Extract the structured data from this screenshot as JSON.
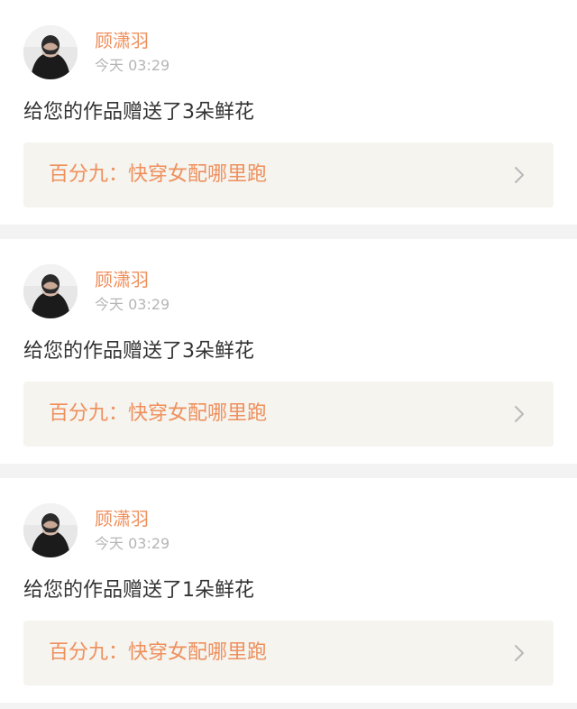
{
  "feed": {
    "items": [
      {
        "username": "顾潇羽",
        "time": "今天 03:29",
        "message": "给您的作品赠送了3朵鲜花",
        "work_title": "百分九：快穿女配哪里跑",
        "chevron_icon": "chevron-right-icon",
        "avatar_icon": "avatar-icon"
      },
      {
        "username": "顾潇羽",
        "time": "今天 03:29",
        "message": "给您的作品赠送了3朵鲜花",
        "work_title": "百分九：快穿女配哪里跑",
        "chevron_icon": "chevron-right-icon",
        "avatar_icon": "avatar-icon"
      },
      {
        "username": "顾潇羽",
        "time": "今天 03:29",
        "message": "给您的作品赠送了1朵鲜花",
        "work_title": "百分九：快穿女配哪里跑",
        "chevron_icon": "chevron-right-icon",
        "avatar_icon": "avatar-icon"
      }
    ]
  },
  "colors": {
    "accent": "#ef8f5c",
    "text": "#333333",
    "muted": "#b5b5b5",
    "card_bg": "#ffffff",
    "link_bg": "#f5f4ef",
    "page_bg": "#f3f3f3"
  }
}
